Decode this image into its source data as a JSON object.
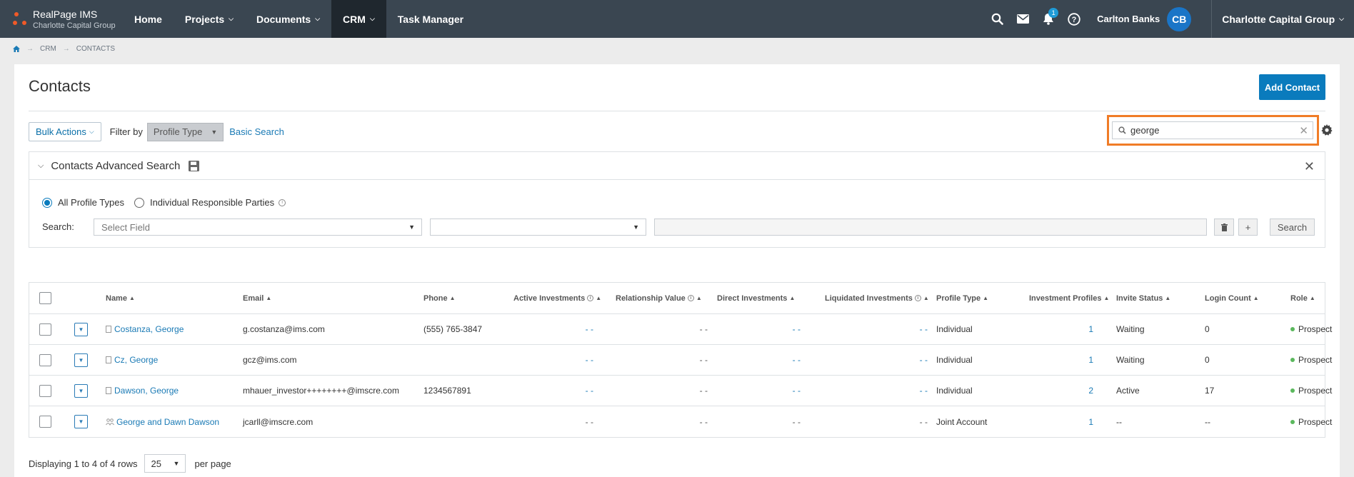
{
  "app": {
    "name": "RealPage IMS",
    "org": "Charlotte Capital Group"
  },
  "nav": {
    "items": [
      {
        "label": "Home",
        "dropdown": false
      },
      {
        "label": "Projects",
        "dropdown": true
      },
      {
        "label": "Documents",
        "dropdown": true
      },
      {
        "label": "CRM",
        "dropdown": true,
        "active": true
      },
      {
        "label": "Task Manager",
        "dropdown": false
      }
    ],
    "notification_count": "1",
    "user_name": "Carlton Banks",
    "user_initials": "CB",
    "org_switch": "Charlotte Capital Group"
  },
  "breadcrumb": {
    "items": [
      "CRM",
      "CONTACTS"
    ]
  },
  "page": {
    "title": "Contacts",
    "add_button": "Add Contact"
  },
  "toolbar": {
    "bulk_actions": "Bulk Actions",
    "filter_label": "Filter by",
    "profile_type": "Profile Type",
    "basic_search": "Basic Search",
    "search_value": "george"
  },
  "advanced": {
    "title": "Contacts Advanced Search",
    "radio_all": "All Profile Types",
    "radio_irp": "Individual Responsible Parties",
    "search_label": "Search:",
    "field_placeholder": "Select Field",
    "search_button": "Search",
    "add_button": "+"
  },
  "table": {
    "headers": {
      "name": "Name",
      "email": "Email",
      "phone": "Phone",
      "active_inv": "Active Investments",
      "rel_value": "Relationship Value",
      "direct_inv": "Direct Investments",
      "liq_inv": "Liquidated Investments",
      "profile_type": "Profile Type",
      "inv_profiles": "Investment Profiles",
      "invite_status": "Invite Status",
      "login_count": "Login Count",
      "role": "Role"
    },
    "rows": [
      {
        "name": "Costanza, George",
        "email": "g.costanza@ims.com",
        "phone": "(555) 765-3847",
        "active_inv": "- -",
        "rel_value": "- -",
        "direct_inv": "- -",
        "liq_inv": "- -",
        "profile_type": "Individual",
        "inv_profiles": "1",
        "invite_status": "Waiting",
        "login_count": "0",
        "role": "Prospect"
      },
      {
        "name": "Cz, George",
        "email": "gcz@ims.com",
        "phone": "",
        "active_inv": "- -",
        "rel_value": "- -",
        "direct_inv": "- -",
        "liq_inv": "- -",
        "profile_type": "Individual",
        "inv_profiles": "1",
        "invite_status": "Waiting",
        "login_count": "0",
        "role": "Prospect"
      },
      {
        "name": "Dawson, George",
        "email": "mhauer_investor++++++++@imscre.com",
        "phone": "1234567891",
        "active_inv": "- -",
        "rel_value": "- -",
        "direct_inv": "- -",
        "liq_inv": "- -",
        "profile_type": "Individual",
        "inv_profiles": "2",
        "invite_status": "Active",
        "login_count": "17",
        "role": "Prospect"
      },
      {
        "name": "George and Dawn Dawson",
        "email": "jcarll@imscre.com",
        "phone": "",
        "active_inv": "- -",
        "rel_value": "- -",
        "direct_inv": "- -",
        "liq_inv": "- -",
        "profile_type": "Joint Account",
        "inv_profiles": "1",
        "invite_status": "--",
        "login_count": "--",
        "role": "Prospect"
      }
    ]
  },
  "footer": {
    "displaying": "Displaying 1 to 4 of 4 rows",
    "per_page_value": "25",
    "per_page_label": "per page"
  },
  "colors": {
    "nav_bg": "#3a4651",
    "accent": "#0a7bbd",
    "highlight": "#f07c27",
    "prospect": "#5bb85d"
  }
}
